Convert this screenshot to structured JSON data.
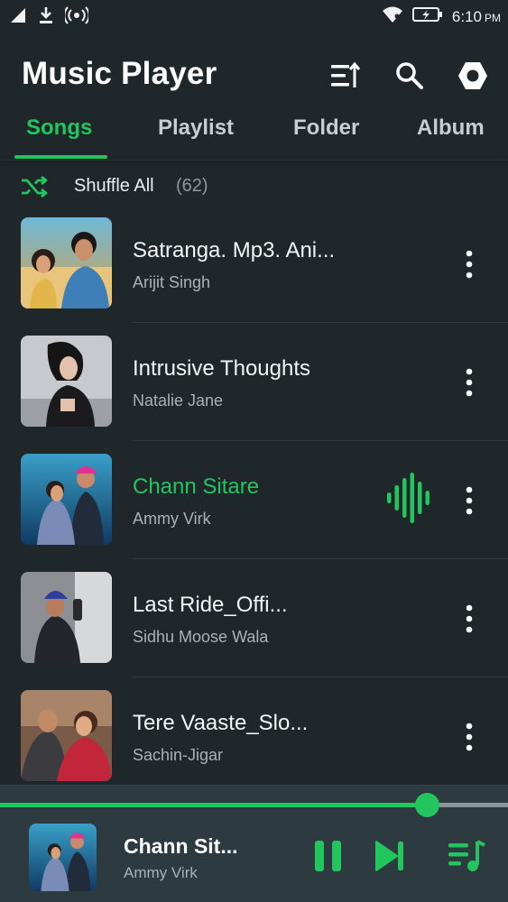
{
  "status_bar": {
    "time": "6:10",
    "ampm": "PM",
    "icons": [
      "signal-icon",
      "download-icon",
      "hotspot-icon",
      "wifi-icon",
      "battery-charging-icon"
    ]
  },
  "header": {
    "title": "Music Player",
    "icons": [
      "sort-icon",
      "search-icon",
      "settings-icon"
    ]
  },
  "tabs": [
    {
      "label": "Songs",
      "active": true
    },
    {
      "label": "Playlist",
      "active": false
    },
    {
      "label": "Folder",
      "active": false
    },
    {
      "label": "Album",
      "active": false
    }
  ],
  "shuffle": {
    "label": "Shuffle All",
    "count": "(62)"
  },
  "songs": [
    {
      "title": "Satranga. Mp3. Ani...",
      "artist": "Arijit Singh",
      "playing": false
    },
    {
      "title": "Intrusive Thoughts",
      "artist": "Natalie Jane",
      "playing": false
    },
    {
      "title": "Chann Sitare",
      "artist": "Ammy Virk",
      "playing": true
    },
    {
      "title": "Last Ride_Offi...",
      "artist": "Sidhu Moose Wala",
      "playing": false
    },
    {
      "title": "Tere Vaaste_Slo...",
      "artist": "Sachin-Jigar",
      "playing": false
    }
  ],
  "now_playing": {
    "title": "Chann Sit...",
    "artist": "Ammy Virk",
    "progress": 0.84
  },
  "colors": {
    "accent": "#22c55e",
    "background": "#1f272b",
    "player_bg": "#2d3a40"
  }
}
